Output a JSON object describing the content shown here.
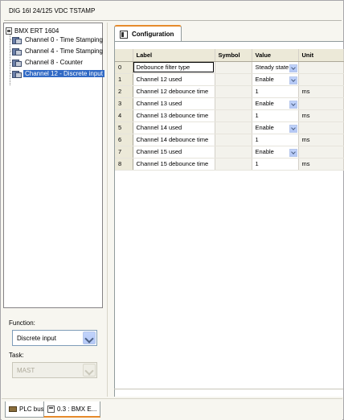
{
  "window": {
    "title": "DIG 16I 24/125 VDC TSTAMP"
  },
  "tree": {
    "root": "BMX ERT 1604",
    "items": [
      {
        "label": "Channel 0 - Time Stamping",
        "selected": false
      },
      {
        "label": "Channel 4 - Time Stamping",
        "selected": false
      },
      {
        "label": "Channel 8 - Counter",
        "selected": false
      },
      {
        "label": "Channel 12 - Discrete input",
        "selected": true
      }
    ]
  },
  "function_panel": {
    "function_label": "Function:",
    "function_value": "Discrete input",
    "task_label": "Task:",
    "task_value": "MAST"
  },
  "config": {
    "tab_label": "Configuration",
    "columns": [
      "",
      "Label",
      "Symbol",
      "Value",
      "Unit"
    ],
    "rows": [
      {
        "idx": "0",
        "label": "Debounce filter type",
        "symbol": "",
        "value": "Steady state",
        "unit": "",
        "combo": true
      },
      {
        "idx": "1",
        "label": "Channel 12 used",
        "symbol": "",
        "value": "Enable",
        "unit": "",
        "combo": true
      },
      {
        "idx": "2",
        "label": "Channel 12 debounce time",
        "symbol": "",
        "value": "1",
        "unit": "ms",
        "combo": false
      },
      {
        "idx": "3",
        "label": "Channel 13 used",
        "symbol": "",
        "value": "Enable",
        "unit": "",
        "combo": true
      },
      {
        "idx": "4",
        "label": "Channel 13 debounce time",
        "symbol": "",
        "value": "1",
        "unit": "ms",
        "combo": false
      },
      {
        "idx": "5",
        "label": "Channel 14 used",
        "symbol": "",
        "value": "Enable",
        "unit": "",
        "combo": true
      },
      {
        "idx": "6",
        "label": "Channel 14 debounce time",
        "symbol": "",
        "value": "1",
        "unit": "ms",
        "combo": false
      },
      {
        "idx": "7",
        "label": "Channel 15 used",
        "symbol": "",
        "value": "Enable",
        "unit": "",
        "combo": true
      },
      {
        "idx": "8",
        "label": "Channel 15 debounce time",
        "symbol": "",
        "value": "1",
        "unit": "ms",
        "combo": false
      }
    ]
  },
  "bottom_tabs": [
    {
      "label": "PLC bus",
      "icon": "plc-bus-icon"
    },
    {
      "label": "0.3 : BMX E...",
      "icon": "module-icon"
    }
  ]
}
